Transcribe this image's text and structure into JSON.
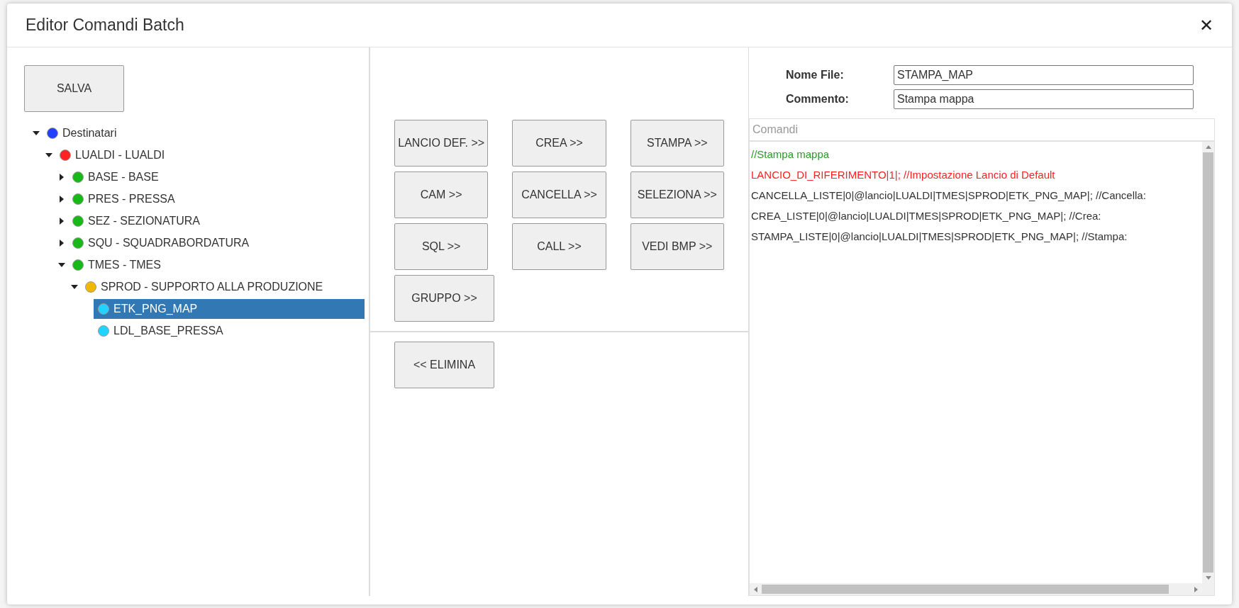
{
  "window": {
    "title": "Editor Comandi Batch",
    "close": "✕"
  },
  "save_button": "SALVA",
  "tree": [
    {
      "label": "Destinatari",
      "color": "#2241ff",
      "expanded": true,
      "selected": false,
      "children": [
        {
          "label": "LUALDI - LUALDI",
          "color": "#ff2222",
          "expanded": true,
          "selected": false,
          "children": [
            {
              "label": "BASE - BASE",
              "color": "#18b818",
              "expanded": false,
              "selected": false
            },
            {
              "label": "PRES - PRESSA",
              "color": "#18b818",
              "expanded": false,
              "selected": false
            },
            {
              "label": "SEZ - SEZIONATURA",
              "color": "#18b818",
              "expanded": false,
              "selected": false
            },
            {
              "label": "SQU - SQUADRABORDATURA",
              "color": "#18b818",
              "expanded": false,
              "selected": false
            },
            {
              "label": "TMES - TMES",
              "color": "#18b818",
              "expanded": true,
              "selected": false,
              "children": [
                {
                  "label": "SPROD - SUPPORTO ALLA PRODUZIONE",
                  "color": "#f0b800",
                  "expanded": true,
                  "selected": false,
                  "children": [
                    {
                      "label": "ETK_PNG_MAP",
                      "color": "#22d3ff",
                      "selected": true
                    },
                    {
                      "label": "LDL_BASE_PRESSA",
                      "color": "#22d3ff",
                      "selected": false
                    }
                  ]
                }
              ]
            }
          ]
        }
      ]
    }
  ],
  "command_buttons": [
    [
      "LANCIO DEF. >>",
      "CREA >>",
      "STAMPA >>"
    ],
    [
      "CAM >>",
      "CANCELLA >>",
      "SELEZIONA >>"
    ],
    [
      "SQL >>",
      "CALL >>",
      "VEDI BMP >>"
    ],
    [
      "GRUPPO >>"
    ]
  ],
  "delete_button": "<< ELIMINA",
  "fields": [
    {
      "label": "Nome File:",
      "value": "STAMPA_MAP"
    },
    {
      "label": "Commento:",
      "value": "Stampa mappa"
    }
  ],
  "commands": {
    "placeholder": "Comandi",
    "lines": [
      {
        "kind": "comment",
        "text": "//Stampa mappa"
      },
      {
        "kind": "reference",
        "text": "LANCIO_DI_RIFERIMENTO|1|; //Impostazione Lancio di Default"
      },
      {
        "kind": "normal",
        "text": "CANCELLA_LISTE|0|@lancio|LUALDI|TMES|SPROD|ETK_PNG_MAP|; //Cancella:"
      },
      {
        "kind": "normal",
        "text": "CREA_LISTE|0|@lancio|LUALDI|TMES|SPROD|ETK_PNG_MAP|; //Crea:"
      },
      {
        "kind": "normal",
        "text": "STAMPA_LISTE|0|@lancio|LUALDI|TMES|SPROD|ETK_PNG_MAP|; //Stampa:"
      }
    ]
  }
}
